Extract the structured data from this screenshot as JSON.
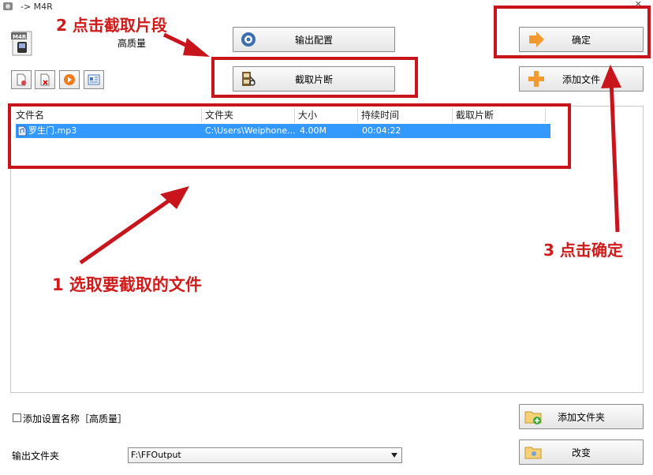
{
  "window": {
    "title": "-> M4R",
    "close": "×"
  },
  "profile": {
    "quality_label": "高质量",
    "badge": "M4R"
  },
  "buttons": {
    "output_config": "输出配置",
    "clip_segment": "截取片断",
    "ok": "确定",
    "add_file": "添加文件",
    "add_folder": "添加文件夹",
    "change": "改变"
  },
  "file_table": {
    "columns": [
      "文件名",
      "文件夹",
      "大小",
      "持续时间",
      "截取片断"
    ],
    "rows": [
      {
        "name": "罗生门.mp3",
        "folder": "C:\\Users\\Weiphone...",
        "size": "4.00M",
        "duration": "00:04:22",
        "clip": ""
      }
    ]
  },
  "options": {
    "add_setting_name_label": "添加设置名称［高质量］",
    "add_setting_name_checked": false,
    "output_folder_label": "输出文件夹",
    "output_folder_value": "F:\\FFOutput"
  },
  "annotations": {
    "step1": "1 选取要截取的文件",
    "step2": "2 点击截取片段",
    "step3": "3 点击确定"
  },
  "colors": {
    "annotation_red": "#c8151b",
    "selection_blue": "#3399ff"
  }
}
